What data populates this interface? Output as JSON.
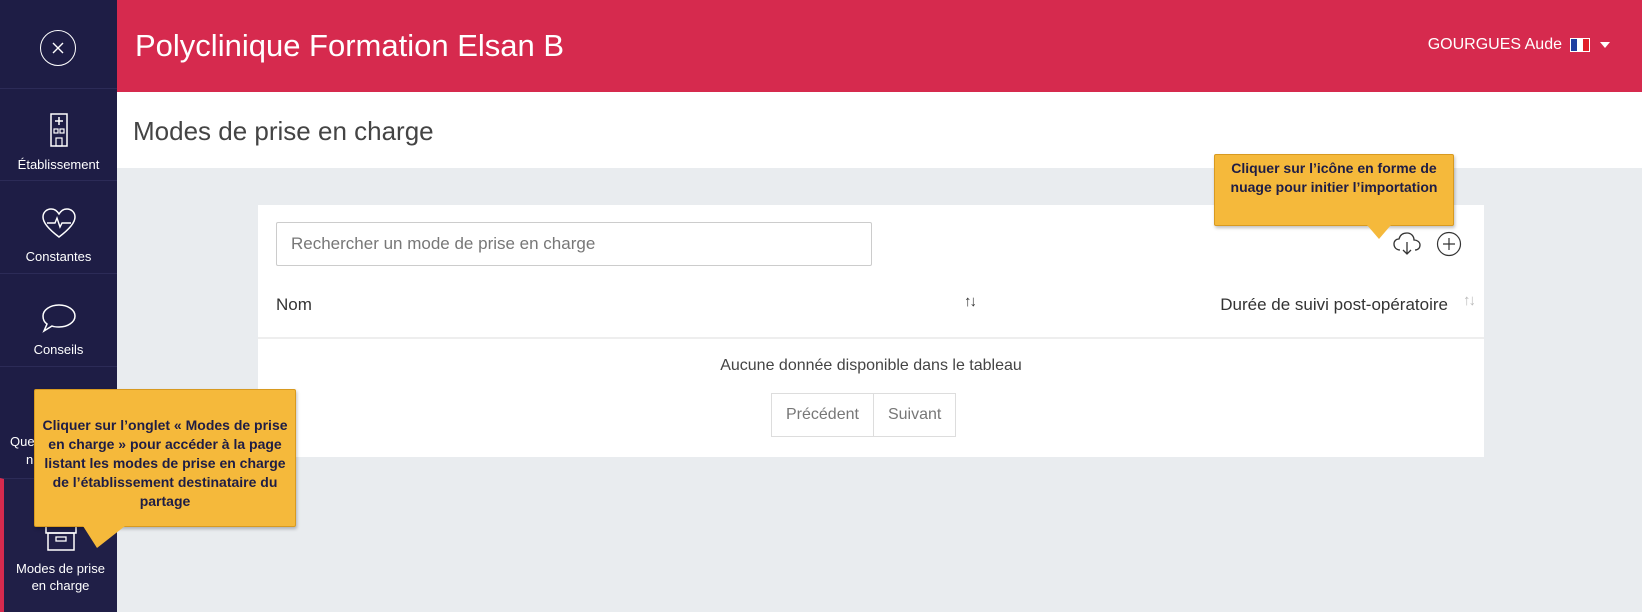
{
  "header": {
    "app_title": "Polyclinique Formation Elsan B",
    "user_name": "GOURGUES Aude",
    "flag_colors": [
      "#1f3fa0",
      "#ffffff",
      "#e0202a"
    ]
  },
  "sidebar": {
    "items": [
      {
        "label": "Établissement",
        "icon": "building-icon"
      },
      {
        "label": "Constantes",
        "icon": "heartbeat-icon"
      },
      {
        "label": "Conseils",
        "icon": "speech-bubble-icon"
      },
      {
        "label": "Qu",
        "icon": "questionnaire-icon"
      },
      {
        "label": "Modes de prise en charge",
        "icon": "archive-box-icon"
      }
    ],
    "partial_labels": [
      "Que",
      "n"
    ]
  },
  "page": {
    "title": "Modes de prise en charge"
  },
  "table": {
    "search_placeholder": "Rechercher un mode de prise en charge",
    "columns": [
      "Nom",
      "Durée de suivi post-opératoire"
    ],
    "empty_message": "Aucune donnée disponible dans le tableau",
    "prev_label": "Précédent",
    "next_label": "Suivant"
  },
  "tooltips": {
    "cloud": "Cliquer sur l’icône en forme de nuage pour initier l’importation",
    "sidebar": "Cliquer sur l’onglet « Modes de prise en charge » pour accéder à la page listant les modes de prise en charge de l’établissement destinataire du partage"
  },
  "colors": {
    "header_bg": "#d62a4e",
    "sidebar_bg": "#1e1d45",
    "tooltip_bg": "#f5b93b"
  }
}
